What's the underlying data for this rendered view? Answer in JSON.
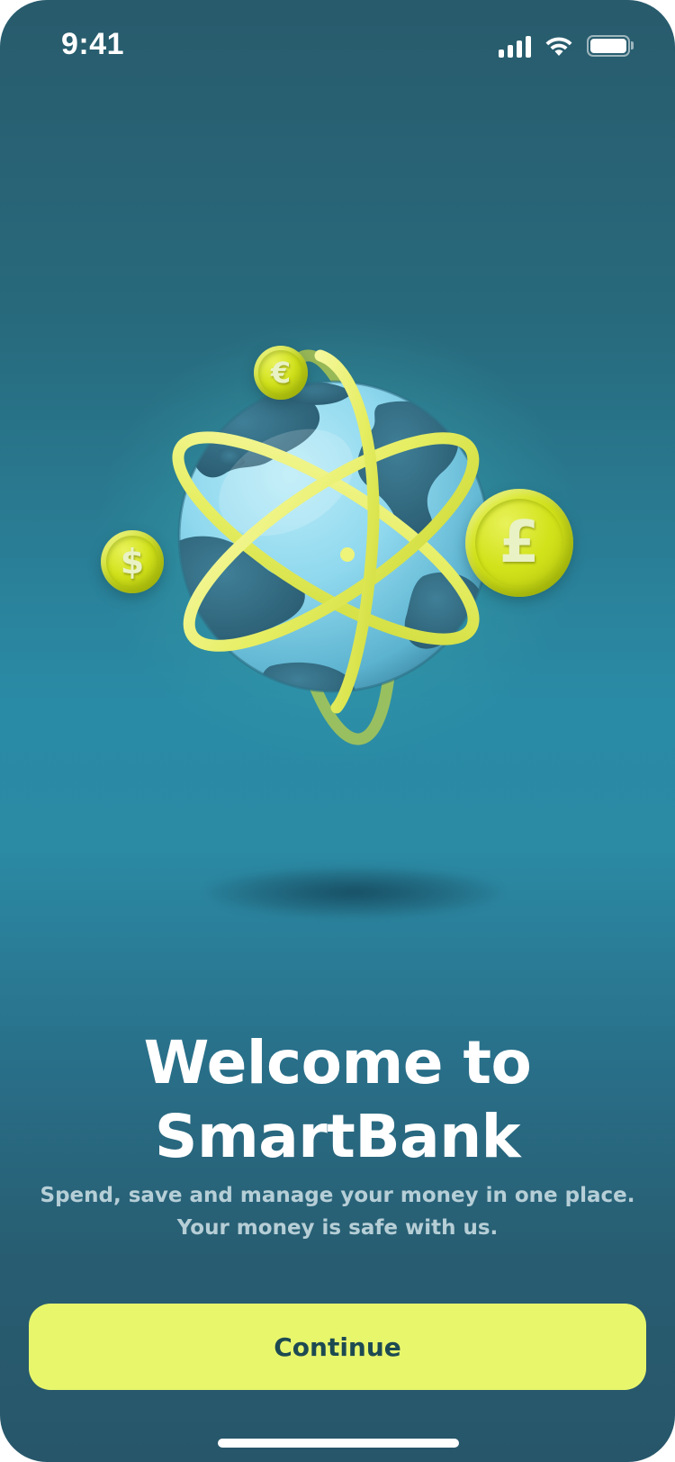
{
  "status_bar": {
    "time": "9:41",
    "icons": [
      "cellular-signal-icon",
      "wifi-icon",
      "battery-icon"
    ]
  },
  "illustration": {
    "name": "globe-with-rings-and-currency-coins",
    "coins": [
      {
        "symbol": "€",
        "icon": "euro-coin-icon"
      },
      {
        "symbol": "$",
        "icon": "dollar-coin-icon"
      },
      {
        "symbol": "£",
        "icon": "pound-coin-icon"
      }
    ]
  },
  "welcome": {
    "title_line1": "Welcome to",
    "title_line2": "SmartBank",
    "subtitle_line1": "Spend, save and manage your money in one place.",
    "subtitle_line2": "Your money is safe with us."
  },
  "actions": {
    "continue_label": "Continue"
  },
  "colors": {
    "background_top": "#285b6c",
    "background_mid": "#2a8ba6",
    "accent": "#e8f66c",
    "button_text": "#1d4a52",
    "coin": "#d2e21a"
  }
}
